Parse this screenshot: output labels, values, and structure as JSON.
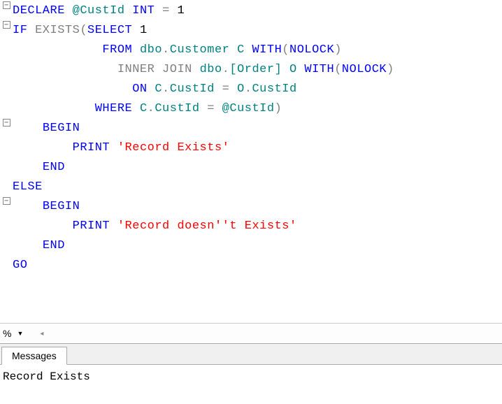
{
  "code": {
    "tokens": [
      [
        {
          "t": "DECLARE",
          "c": "kw"
        },
        {
          "t": " ",
          "c": "txt"
        },
        {
          "t": "@CustId",
          "c": "var"
        },
        {
          "t": " ",
          "c": "txt"
        },
        {
          "t": "INT",
          "c": "kw"
        },
        {
          "t": " ",
          "c": "txt"
        },
        {
          "t": "=",
          "c": "op"
        },
        {
          "t": " ",
          "c": "txt"
        },
        {
          "t": "1",
          "c": "txt"
        }
      ],
      [
        {
          "t": "IF",
          "c": "kw"
        },
        {
          "t": " ",
          "c": "txt"
        },
        {
          "t": "EXISTS",
          "c": "gray"
        },
        {
          "t": "(",
          "c": "gray"
        },
        {
          "t": "SELECT",
          "c": "kw"
        },
        {
          "t": " ",
          "c": "txt"
        },
        {
          "t": "1",
          "c": "txt"
        }
      ],
      [
        {
          "t": "            ",
          "c": "txt"
        },
        {
          "t": "FROM",
          "c": "kw"
        },
        {
          "t": " ",
          "c": "txt"
        },
        {
          "t": "dbo",
          "c": "ident"
        },
        {
          "t": ".",
          "c": "gray"
        },
        {
          "t": "Customer",
          "c": "ident"
        },
        {
          "t": " ",
          "c": "txt"
        },
        {
          "t": "C",
          "c": "ident"
        },
        {
          "t": " ",
          "c": "txt"
        },
        {
          "t": "WITH",
          "c": "kw"
        },
        {
          "t": "(",
          "c": "gray"
        },
        {
          "t": "NOLOCK",
          "c": "kw"
        },
        {
          "t": ")",
          "c": "gray"
        }
      ],
      [
        {
          "t": "              ",
          "c": "txt"
        },
        {
          "t": "INNER",
          "c": "gray"
        },
        {
          "t": " ",
          "c": "txt"
        },
        {
          "t": "JOIN",
          "c": "gray"
        },
        {
          "t": " ",
          "c": "txt"
        },
        {
          "t": "dbo",
          "c": "ident"
        },
        {
          "t": ".",
          "c": "gray"
        },
        {
          "t": "[Order]",
          "c": "ident"
        },
        {
          "t": " ",
          "c": "txt"
        },
        {
          "t": "O",
          "c": "ident"
        },
        {
          "t": " ",
          "c": "txt"
        },
        {
          "t": "WITH",
          "c": "kw"
        },
        {
          "t": "(",
          "c": "gray"
        },
        {
          "t": "NOLOCK",
          "c": "kw"
        },
        {
          "t": ")",
          "c": "gray"
        }
      ],
      [
        {
          "t": "                ",
          "c": "txt"
        },
        {
          "t": "ON",
          "c": "kw"
        },
        {
          "t": " ",
          "c": "txt"
        },
        {
          "t": "C",
          "c": "ident"
        },
        {
          "t": ".",
          "c": "gray"
        },
        {
          "t": "CustId",
          "c": "ident"
        },
        {
          "t": " ",
          "c": "txt"
        },
        {
          "t": "=",
          "c": "op"
        },
        {
          "t": " ",
          "c": "txt"
        },
        {
          "t": "O",
          "c": "ident"
        },
        {
          "t": ".",
          "c": "gray"
        },
        {
          "t": "CustId",
          "c": "ident"
        }
      ],
      [
        {
          "t": "           ",
          "c": "txt"
        },
        {
          "t": "WHERE",
          "c": "kw"
        },
        {
          "t": " ",
          "c": "txt"
        },
        {
          "t": "C",
          "c": "ident"
        },
        {
          "t": ".",
          "c": "gray"
        },
        {
          "t": "CustId",
          "c": "ident"
        },
        {
          "t": " ",
          "c": "txt"
        },
        {
          "t": "=",
          "c": "op"
        },
        {
          "t": " ",
          "c": "txt"
        },
        {
          "t": "@CustId",
          "c": "var"
        },
        {
          "t": ")",
          "c": "gray"
        }
      ],
      [
        {
          "t": "    ",
          "c": "txt"
        },
        {
          "t": "BEGIN",
          "c": "kw"
        }
      ],
      [
        {
          "t": "        ",
          "c": "txt"
        },
        {
          "t": "PRINT",
          "c": "kw"
        },
        {
          "t": " ",
          "c": "txt"
        },
        {
          "t": "'Record Exists'",
          "c": "str"
        }
      ],
      [
        {
          "t": "    ",
          "c": "txt"
        },
        {
          "t": "END",
          "c": "kw"
        }
      ],
      [
        {
          "t": "ELSE",
          "c": "kw"
        }
      ],
      [
        {
          "t": "    ",
          "c": "txt"
        },
        {
          "t": "BEGIN",
          "c": "kw"
        }
      ],
      [
        {
          "t": "        ",
          "c": "txt"
        },
        {
          "t": "PRINT",
          "c": "kw"
        },
        {
          "t": " ",
          "c": "txt"
        },
        {
          "t": "'Record doesn''t Exists'",
          "c": "str"
        }
      ],
      [
        {
          "t": "    ",
          "c": "txt"
        },
        {
          "t": "END",
          "c": "kw"
        }
      ],
      [
        {
          "t": "GO",
          "c": "kw"
        }
      ]
    ],
    "fold_markers": [
      "minus",
      "minus",
      "",
      "",
      "",
      "",
      "minus",
      "",
      "",
      "",
      "minus",
      "",
      "",
      ""
    ]
  },
  "splitter": {
    "zoom": "%"
  },
  "tabs": {
    "messages": "Messages"
  },
  "output": {
    "text": "Record Exists"
  }
}
